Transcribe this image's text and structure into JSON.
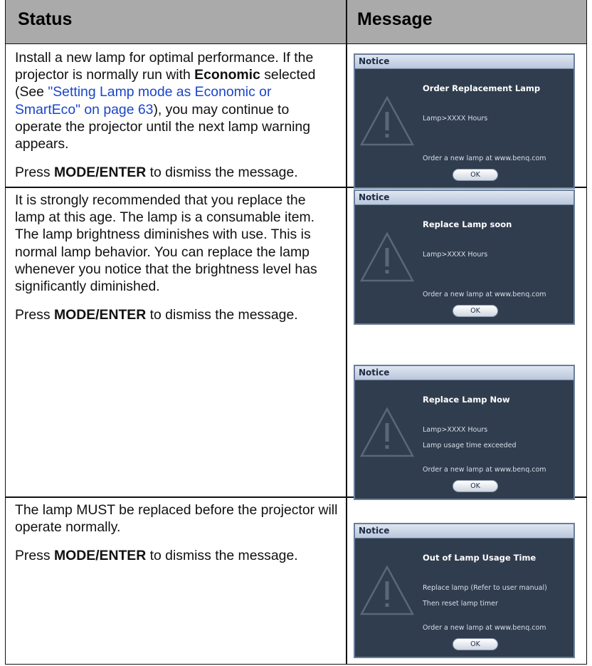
{
  "header": {
    "status": "Status",
    "message": "Message"
  },
  "rows": [
    {
      "status": {
        "p1_before": "Install a new lamp for optimal performance. If the projector is normally run with ",
        "p1_bold": "Economic",
        "p1_mid": " selected (See ",
        "p1_link": "\"Setting Lamp mode as Economic or SmartEco\" on page 63",
        "p1_after": "), you may continue to operate the projector until the next lamp warning appears.",
        "press": "Press ",
        "key": "MODE/ENTER",
        "dismiss": " to dismiss the message."
      },
      "notices": [
        {
          "bar": "Notice",
          "title": "Order Replacement Lamp",
          "line1": "Lamp>XXXX Hours",
          "line2": "",
          "order": "Order a new lamp at www.benq.com",
          "ok": "OK"
        }
      ]
    },
    {
      "status": {
        "p1": "It is strongly recommended that you replace the lamp at this age. The lamp is a consumable item. The lamp brightness diminishes with use. This is normal lamp behavior. You can replace the lamp whenever you notice that the brightness level has significantly diminished.",
        "press": "Press ",
        "key": "MODE/ENTER",
        "dismiss": " to dismiss the message."
      },
      "notices": [
        {
          "bar": "Notice",
          "title": "Replace Lamp soon",
          "line1": "Lamp>XXXX Hours",
          "line2": "",
          "order": "Order a new lamp at www.benq.com",
          "ok": "OK"
        },
        {
          "bar": "Notice",
          "title": "Replace Lamp Now",
          "line1": "Lamp>XXXX Hours",
          "line2": "Lamp usage time exceeded",
          "order": "Order a new lamp at www.benq.com",
          "ok": "OK"
        }
      ]
    },
    {
      "status": {
        "p1": "The lamp MUST be replaced before the projector will operate normally.",
        "press": "Press ",
        "key": "MODE/ENTER",
        "dismiss": " to dismiss the message."
      },
      "notices": [
        {
          "bar": "Notice",
          "title": "Out of Lamp Usage Time",
          "line1": "Replace lamp (Refer to user manual)",
          "line2": "Then reset lamp timer",
          "order": "Order a new lamp at www.benq.com",
          "ok": "OK"
        }
      ]
    }
  ]
}
